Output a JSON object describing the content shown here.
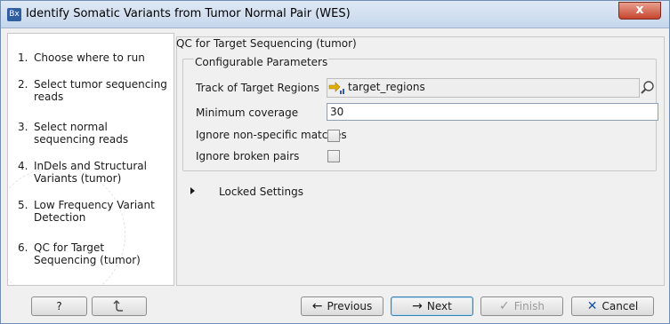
{
  "window": {
    "app_icon_text": "Bx",
    "title": "Identify Somatic Variants from Tumor Normal Pair (WES)",
    "close_label": "x"
  },
  "steps": [
    {
      "num": "1.",
      "label": "Choose where to run"
    },
    {
      "num": "2.",
      "label": "Select tumor sequencing reads"
    },
    {
      "num": "3.",
      "label": "Select normal sequencing reads"
    },
    {
      "num": "4.",
      "label": "InDels and Structural Variants (tumor)"
    },
    {
      "num": "5.",
      "label": "Low Frequency Variant Detection"
    },
    {
      "num": "6.",
      "label": "QC for Target Sequencing (tumor)"
    }
  ],
  "panel": {
    "header": "QC for Target Sequencing (tumor)",
    "group_title": "Configurable Parameters",
    "params": {
      "track_label": "Track of Target Regions",
      "track_value": "target_regions",
      "min_cov_label": "Minimum coverage",
      "min_cov_value": "30",
      "ignore_nonspecific_label": "Ignore non-specific matches",
      "ignore_nonspecific_checked": false,
      "ignore_broken_label": "Ignore broken pairs",
      "ignore_broken_checked": false
    },
    "locked_label": "Locked Settings"
  },
  "buttons": {
    "help": "?",
    "previous": "Previous",
    "next": "Next",
    "finish": "Finish",
    "cancel": "Cancel"
  },
  "colors": {
    "accent": "#3c7fb1",
    "cancel_icon": "#1a4fa0",
    "track_icon": "#e0b000"
  },
  "icons": {
    "help": "question-icon",
    "reset": "reset-icon",
    "previous": "arrow-left-icon",
    "next": "arrow-right-icon",
    "finish": "checkmark-icon",
    "cancel": "x-icon",
    "track": "track-icon",
    "browse": "browse-icon"
  }
}
